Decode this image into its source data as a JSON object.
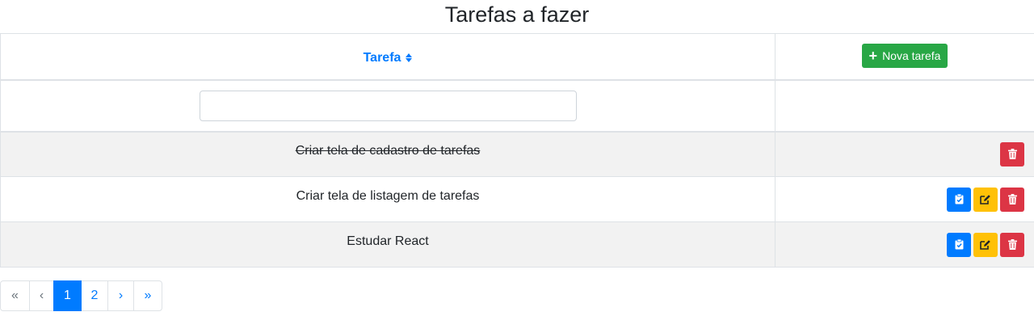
{
  "page": {
    "title": "Tarefas a fazer"
  },
  "table": {
    "column_title": "Tarefa",
    "new_task_label": "Nova tarefa",
    "filter_value": "",
    "rows": [
      {
        "title": "Criar tela de cadastro de tarefas",
        "completed": true
      },
      {
        "title": "Criar tela de listagem de tarefas",
        "completed": false
      },
      {
        "title": "Estudar React",
        "completed": false
      }
    ]
  },
  "pagination": {
    "first": "«",
    "prev": "‹",
    "pages": [
      "1",
      "2"
    ],
    "active_page": "1",
    "next": "›",
    "last": "»"
  },
  "colors": {
    "primary": "#007bff",
    "success": "#28a745",
    "warning": "#ffc107",
    "danger": "#dc3545"
  },
  "icons": {
    "sort": "sort-icon",
    "add": "plus-icon",
    "complete": "clipboard-check-icon",
    "edit": "edit-icon",
    "delete": "trash-icon"
  }
}
